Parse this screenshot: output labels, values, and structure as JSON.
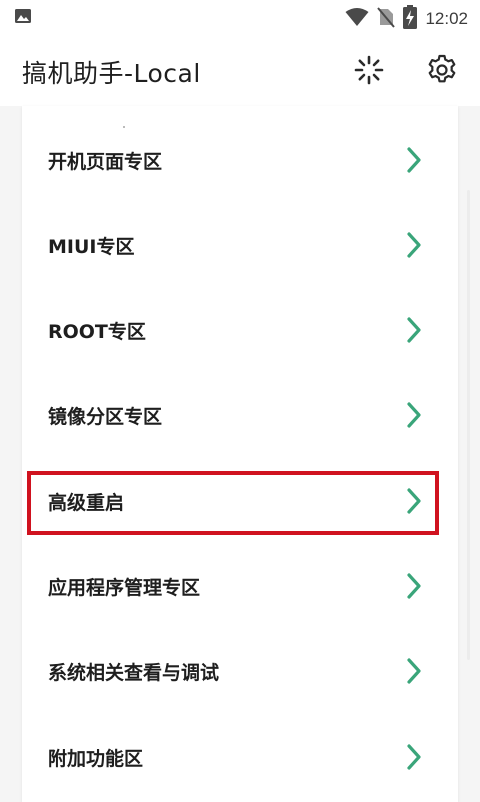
{
  "status_bar": {
    "time": "12:02",
    "icons": [
      "image-icon",
      "wifi-icon",
      "no-sim-icon",
      "battery-charging-icon"
    ]
  },
  "app_bar": {
    "title": "搞机助手-Local",
    "actions": [
      "loading-icon",
      "settings-icon"
    ]
  },
  "menu": {
    "items": [
      {
        "label": "开机页面专区"
      },
      {
        "label": "MIUI专区"
      },
      {
        "label": "ROOT专区"
      },
      {
        "label": "镜像分区专区"
      },
      {
        "label": "高级重启",
        "highlighted": true
      },
      {
        "label": "应用程序管理专区"
      },
      {
        "label": "系统相关查看与调试"
      },
      {
        "label": "附加功能区"
      }
    ]
  },
  "colors": {
    "chevron": "#3aa57a",
    "highlight": "#d0121f",
    "title": "#1f1f1f"
  }
}
